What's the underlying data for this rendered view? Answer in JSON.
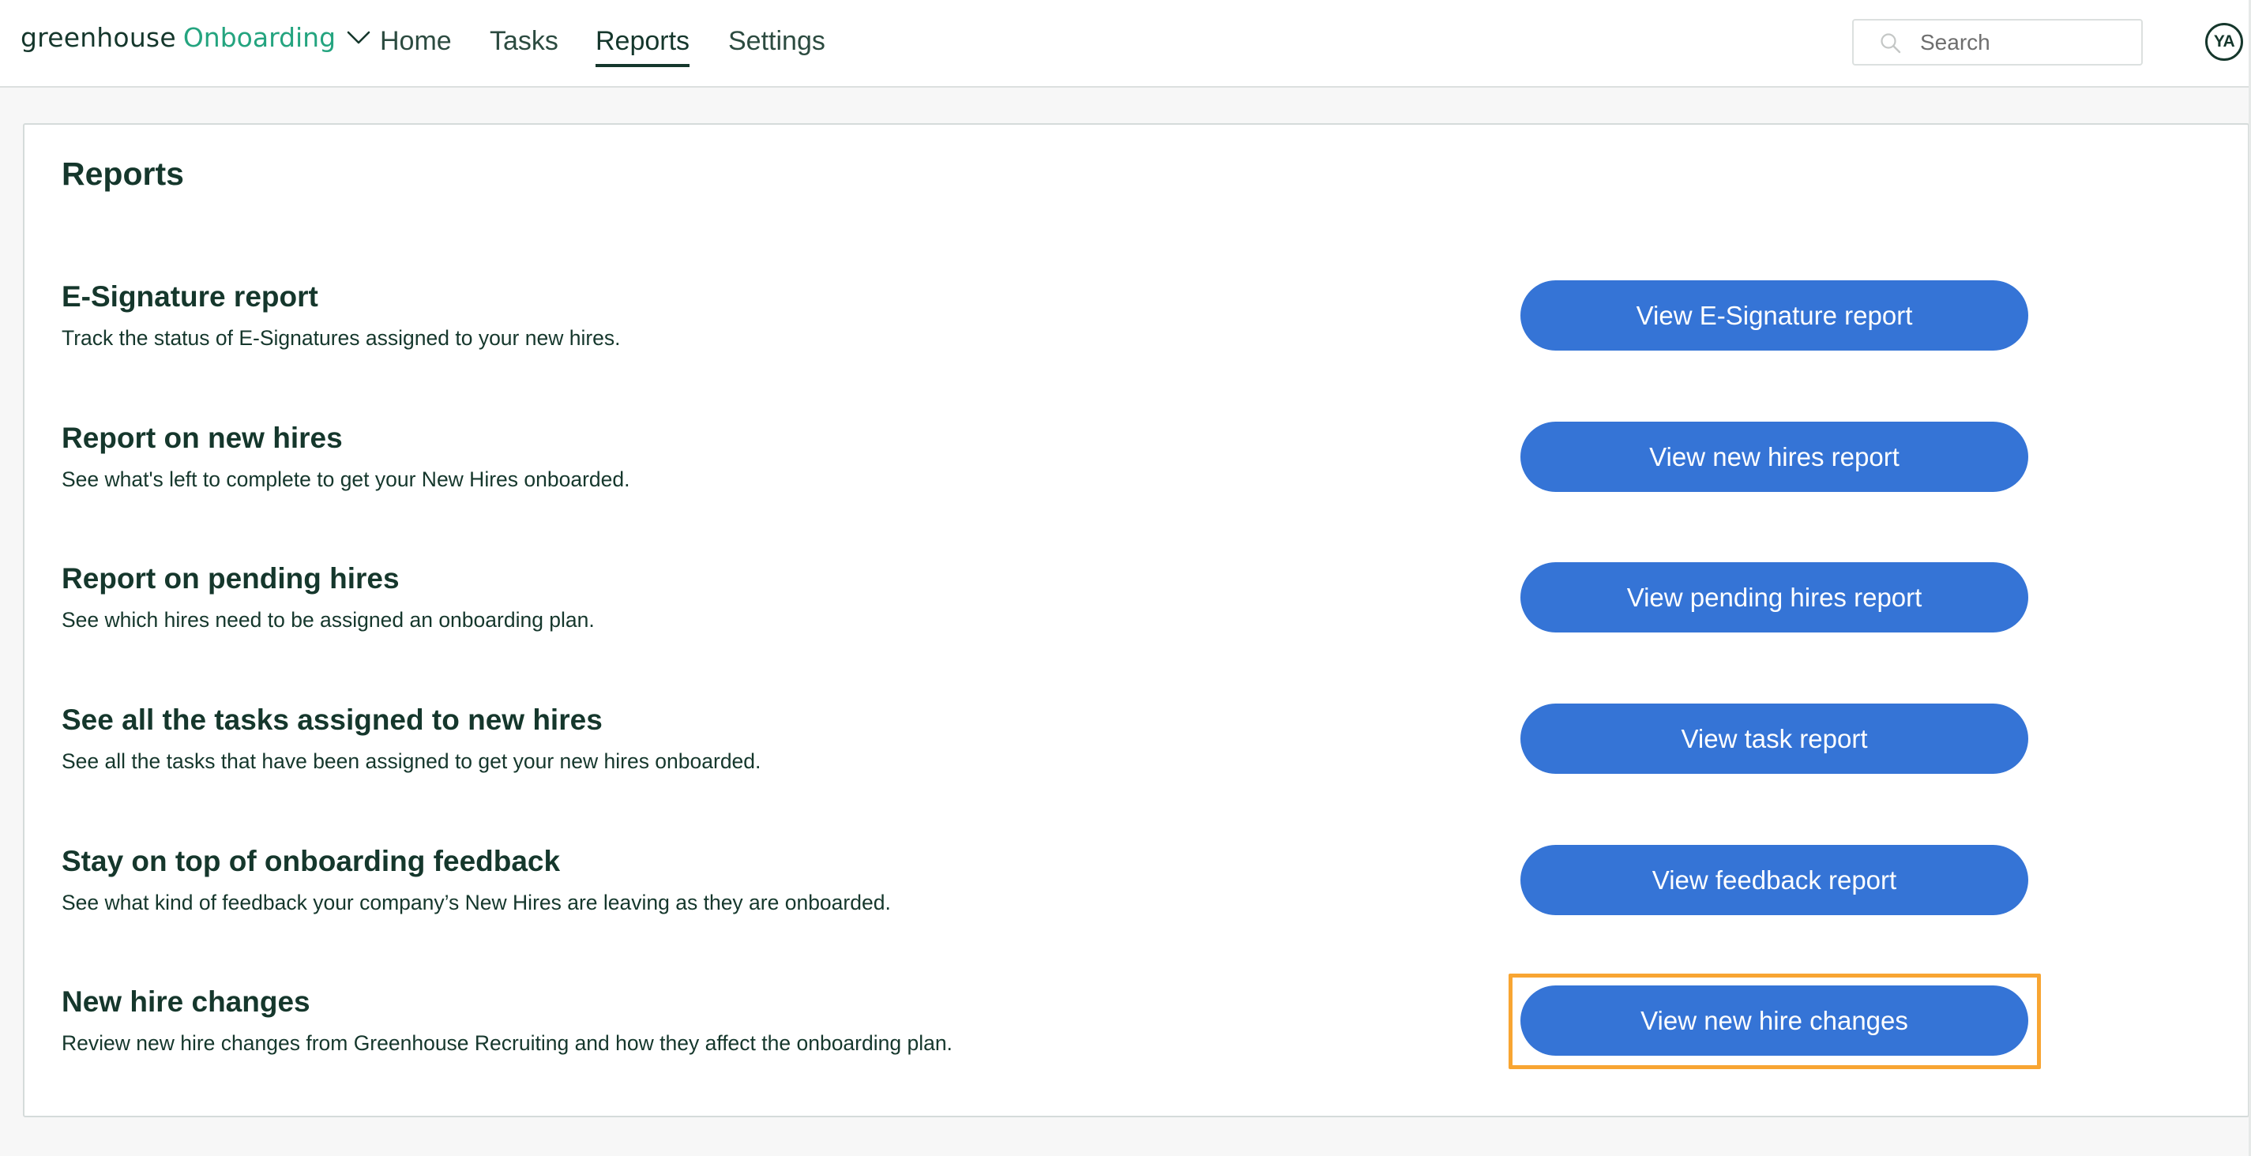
{
  "header": {
    "brand": {
      "company": "greenhouse",
      "product": "Onboarding",
      "company_color": "#15372C",
      "product_color": "#24A47F",
      "switcher_icon": "chevron-down-icon"
    },
    "nav": [
      {
        "label": "Home",
        "active": false
      },
      {
        "label": "Tasks",
        "active": false
      },
      {
        "label": "Reports",
        "active": true
      },
      {
        "label": "Settings",
        "active": false
      }
    ],
    "search": {
      "placeholder": "Search",
      "value": "",
      "icon": "search-icon"
    },
    "avatar": {
      "initials": "YA"
    }
  },
  "page": {
    "title": "Reports",
    "reports": [
      {
        "title": "E-Signature report",
        "description": "Track the status of E-Signatures assigned to your new hires.",
        "button_label": "View E-Signature report",
        "highlighted": false
      },
      {
        "title": "Report on new hires",
        "description": "See what's left to complete to get your New Hires onboarded.",
        "button_label": "View new hires report",
        "highlighted": false
      },
      {
        "title": "Report on pending hires",
        "description": "See which hires need to be assigned an onboarding plan.",
        "button_label": "View pending hires report",
        "highlighted": false
      },
      {
        "title": "See all the tasks assigned to new hires",
        "description": "See all the tasks that have been assigned to get your new hires onboarded.",
        "button_label": "View task report",
        "highlighted": false
      },
      {
        "title": "Stay on top of onboarding feedback",
        "description": "See what kind of feedback your company’s New Hires are leaving as they are onboarded.",
        "button_label": "View feedback report",
        "highlighted": false
      },
      {
        "title": "New hire changes",
        "description": "Review new hire changes from Greenhouse Recruiting and how they affect the onboarding plan.",
        "button_label": "View new hire changes",
        "highlighted": true
      }
    ]
  },
  "colors": {
    "primary_button": "#3574D6",
    "text_dark_green": "#15372C",
    "highlight_outline": "#F8A532",
    "page_background": "#F7F7F7"
  }
}
